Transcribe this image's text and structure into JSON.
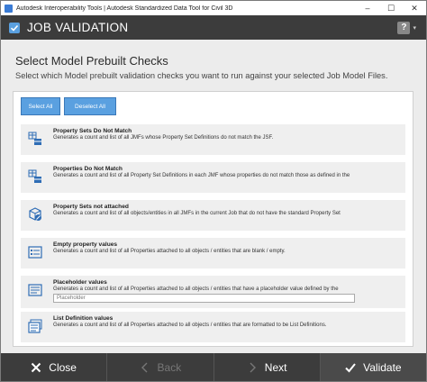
{
  "window": {
    "title": "Autodesk Interoperability Tools | Autodesk Standardized Data Tool for Civil 3D",
    "minimize": "–",
    "maximize": "☐",
    "close": "✕"
  },
  "header": {
    "title": "JOB VALIDATION",
    "help": "?",
    "dropdown": "▾"
  },
  "main": {
    "heading": "Select Model Prebuilt Checks",
    "subheading": "Select which Model prebuilt validation checks you want to run against your selected Job Model Files.",
    "select_all": "Select All",
    "deselect_all": "Deselect All",
    "items": [
      {
        "title": "Property Sets Do Not Match",
        "desc": "Generates a count and list of all JMFs whose Property Set Definitions do not match the JSF.",
        "icon": "table-compare-icon"
      },
      {
        "title": "Properties Do Not Match",
        "desc": "Generates a count and list of all Property Set Definitions in each JMF whose properties do not match those as defined in the",
        "icon": "table-compare-icon"
      },
      {
        "title": "Property Sets not attached",
        "desc": "Generates a count and list of all objects/entities in all JMFs in the current Job that do not have the standard Property Set",
        "icon": "cube-unlinked-icon"
      },
      {
        "title": "Empty property values",
        "desc": "Generates a count and list of all Properties attached to all objects / entities that are blank / empty.",
        "icon": "form-empty-icon"
      },
      {
        "title": "Placeholder values",
        "desc": "Generates a count and list of all Properties attached to all objects / entities that have a placeholder value defined by the",
        "icon": "form-placeholder-icon",
        "input_placeholder": "Placeholder"
      },
      {
        "title": "List Definition values",
        "desc": "Generates a count and list of all Properties attached to all objects / entities that are formatted to be List Definitions.",
        "icon": "list-stack-icon"
      }
    ]
  },
  "footer": {
    "close": "Close",
    "back": "Back",
    "next": "Next",
    "validate": "Validate"
  },
  "colors": {
    "header_bg": "#3c3c3c",
    "button_blue": "#5aa0e0",
    "icon_blue": "#2f6db5"
  }
}
